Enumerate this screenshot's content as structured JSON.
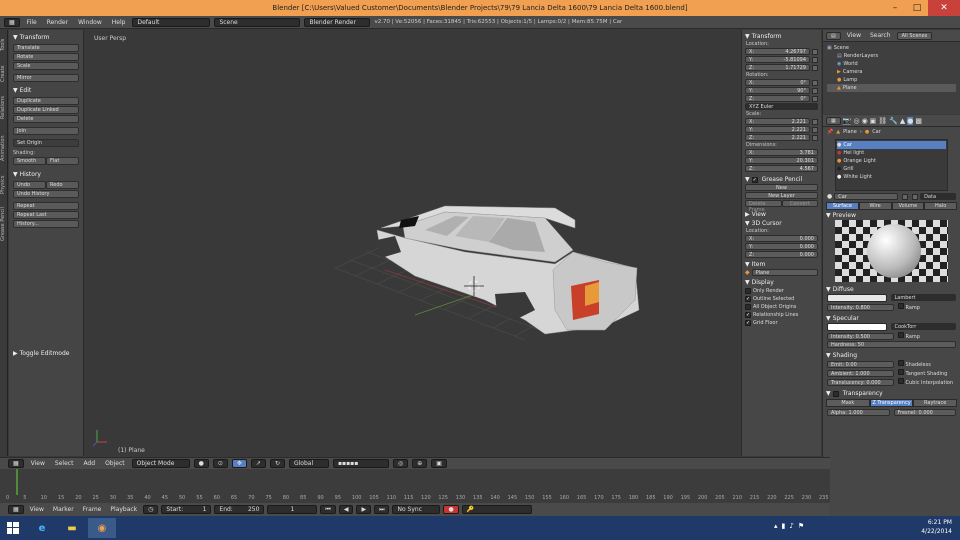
{
  "titlebar": {
    "title": "Blender [C:\\Users\\Valued Customer\\Documents\\Blender Projects\\79\\79 Lancia Delta 1600\\79 Lancia Delta 1600.blend]"
  },
  "menu": {
    "items": [
      "File",
      "Render",
      "Window",
      "Help"
    ],
    "layout": "Default",
    "scene": "Scene",
    "engine": "Blender Render",
    "stats": "v2.70 | Ve:52056 | Faces:31845 | Tris:62553 | Objects:1/5 | Lamps:0/2 | Mem:85.75M | Car"
  },
  "toolshelf": {
    "tabs": [
      "Tools",
      "Create",
      "Relations",
      "Animation",
      "Physics",
      "Grease Pencil"
    ],
    "transform_head": "Transform",
    "transform": [
      "Translate",
      "Rotate",
      "Scale",
      "Mirror"
    ],
    "edit_head": "Edit",
    "edit": [
      "Duplicate",
      "Duplicate Linked",
      "Delete",
      "Join",
      "Set Origin"
    ],
    "shading_label": "Shading:",
    "shading": [
      "Smooth",
      "Flat"
    ],
    "history_head": "History",
    "history": [
      "Undo",
      "Redo",
      "Undo History",
      "Repeat",
      "Repeat Last",
      "History..."
    ],
    "toggle_editmode": "Toggle Editmode"
  },
  "viewport": {
    "label": "User Persp",
    "object_label": "(1) Plane"
  },
  "nprops": {
    "transform_head": "Transform",
    "location_label": "Location:",
    "location": [
      {
        "axis": "X:",
        "value": "4.26797"
      },
      {
        "axis": "Y:",
        "value": "-5.81094"
      },
      {
        "axis": "Z:",
        "value": "1.71729"
      }
    ],
    "rotation_label": "Rotation:",
    "rotation": [
      {
        "axis": "X:",
        "value": "0°"
      },
      {
        "axis": "Y:",
        "value": "90°"
      },
      {
        "axis": "Z:",
        "value": "0°"
      }
    ],
    "rot_mode": "XYZ Euler",
    "scale_label": "Scale:",
    "scale": [
      {
        "axis": "X:",
        "value": "2.221"
      },
      {
        "axis": "Y:",
        "value": "2.221"
      },
      {
        "axis": "Z:",
        "value": "2.221"
      }
    ],
    "dimensions_label": "Dimensions:",
    "dimensions": [
      {
        "axis": "X:",
        "value": "3.781"
      },
      {
        "axis": "Y:",
        "value": "20.301"
      },
      {
        "axis": "Z:",
        "value": "4.567"
      }
    ],
    "grease_head": "Grease Pencil",
    "grease_buttons": [
      "New",
      "New Layer"
    ],
    "grease_sub": [
      "Delete Frame",
      "Convert"
    ],
    "view_head": "View",
    "cursor_head": "3D Cursor",
    "cursor_label": "Location:",
    "cursor": [
      {
        "axis": "X:",
        "value": "0.000"
      },
      {
        "axis": "Y:",
        "value": "0.000"
      },
      {
        "axis": "Z:",
        "value": "0.000"
      }
    ],
    "item_head": "Item",
    "item_name": "Plane",
    "display_head": "Display",
    "display": [
      {
        "label": "Only Render",
        "checked": false
      },
      {
        "label": "Outline Selected",
        "checked": true
      },
      {
        "label": "All Object Origins",
        "checked": false
      },
      {
        "label": "Relationship Lines",
        "checked": true
      },
      {
        "label": "Grid Floor",
        "checked": true
      }
    ]
  },
  "outliner": {
    "tabs": [
      "View",
      "Search",
      "All Scenes"
    ],
    "rows": [
      "Scene",
      "RenderLayers",
      "World",
      "Camera",
      "Lamp",
      "Plane"
    ]
  },
  "props": {
    "breadcrumb": [
      "Plane",
      "Car"
    ],
    "materials": [
      "Car",
      "Hel light",
      "Orange Light",
      "Grill",
      "White Light"
    ],
    "material_name": "Car",
    "data_type": "Data",
    "tabs": [
      "Surface",
      "Wire",
      "Volume",
      "Halo"
    ],
    "preview_head": "Preview",
    "diffuse_head": "Diffuse",
    "diffuse_shader": "Lambert",
    "diffuse_intensity": "Intensity: 0.800",
    "ramp": "Ramp",
    "specular_head": "Specular",
    "specular_shader": "CookTorr",
    "specular_intensity": "Intensity: 0.500",
    "hardness": "Hardness: 50",
    "shading_head": "Shading",
    "shading": [
      {
        "left": "Emit: 0.00",
        "right": "Shadeless"
      },
      {
        "left": "Ambient: 1.000",
        "right": "Tangent Shading"
      },
      {
        "left": "Translucency: 0.000",
        "right": "Cubic Interpolation"
      }
    ],
    "transparency_head": "Transparency",
    "transp_tabs": [
      "Mask",
      "Z Transparency",
      "Raytrace"
    ],
    "alpha": "Alpha: 1.000",
    "fresnel": "Fresnel: 0.000"
  },
  "timeline": {
    "menus": [
      "View",
      "Select",
      "Add",
      "Object"
    ],
    "mode": "Object Mode",
    "orientation": "Global",
    "footer_menus": [
      "View",
      "Marker",
      "Frame",
      "Playback"
    ],
    "start": "Start:",
    "start_val": "1",
    "end": "End:",
    "end_val": "250",
    "current": "1",
    "sync": "No Sync",
    "ticks": [
      "0",
      "5",
      "10",
      "15",
      "20",
      "25",
      "30",
      "35",
      "40",
      "45",
      "50",
      "55",
      "60",
      "65",
      "70",
      "75",
      "80",
      "85",
      "90",
      "95",
      "100",
      "105",
      "110",
      "115",
      "120",
      "125",
      "130",
      "135",
      "140",
      "145",
      "150",
      "155",
      "160",
      "165",
      "170",
      "175",
      "180",
      "185",
      "190",
      "195",
      "200",
      "205",
      "210",
      "215",
      "220",
      "225",
      "230",
      "235"
    ]
  },
  "taskbar": {
    "time": "6:21 PM",
    "date": "4/22/2014"
  }
}
